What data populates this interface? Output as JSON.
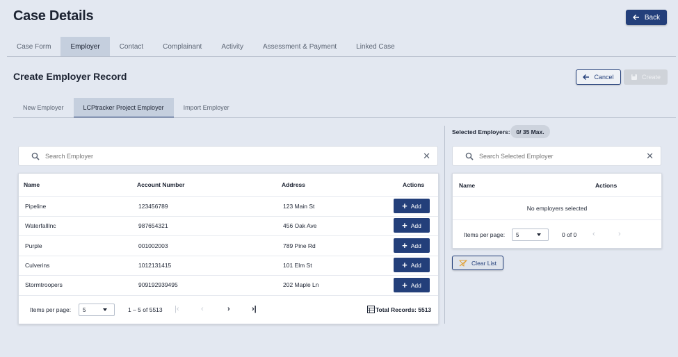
{
  "header": {
    "title": "Case Details",
    "back_label": "Back"
  },
  "tabs": [
    {
      "label": "Case Form"
    },
    {
      "label": "Employer"
    },
    {
      "label": "Contact"
    },
    {
      "label": "Complainant"
    },
    {
      "label": "Activity"
    },
    {
      "label": "Assessment & Payment"
    },
    {
      "label": "Linked Case"
    }
  ],
  "active_tab": "Employer",
  "section": {
    "title": "Create Employer Record",
    "cancel_label": "Cancel",
    "create_label": "Create"
  },
  "subtabs": [
    {
      "label": "New Employer"
    },
    {
      "label": "LCPtracker Project Employer"
    },
    {
      "label": "Import Employer"
    }
  ],
  "active_subtab": "LCPtracker Project Employer",
  "employer_search": {
    "placeholder": "Search Employer"
  },
  "employer_table": {
    "columns": {
      "name": "Name",
      "account": "Account Number",
      "address": "Address",
      "actions": "Actions"
    },
    "add_label": "Add",
    "rows": [
      {
        "name": "Pipeline",
        "account": "123456789",
        "address": "123 Main St"
      },
      {
        "name": "WaterfallInc",
        "account": "987654321",
        "address": "456 Oak Ave"
      },
      {
        "name": "Purple",
        "account": "001002003",
        "address": "789 Pine Rd"
      },
      {
        "name": "Culverins",
        "account": "1012131415",
        "address": "101 Elm St"
      },
      {
        "name": "Stormtroopers",
        "account": "909192939495",
        "address": "202 Maple Ln"
      }
    ],
    "pager": {
      "items_per_page_label": "Items per page:",
      "items_per_page": "5",
      "range": "1 – 5 of 5513",
      "total_records": "Total Records: 5513"
    }
  },
  "selected": {
    "label": "Selected Employers:",
    "badge": "0/ 35 Max.",
    "search_placeholder": "Search Selected Employer",
    "columns": {
      "name": "Name",
      "actions": "Actions"
    },
    "empty_message": "No employers selected",
    "pager": {
      "items_per_page_label": "Items per page:",
      "items_per_page": "5",
      "range": "0 of 0"
    },
    "clear_label": "Clear List"
  },
  "colors": {
    "primary": "#233f7a",
    "background": "#e3e8f1",
    "tab_active": "#c5cfde"
  }
}
